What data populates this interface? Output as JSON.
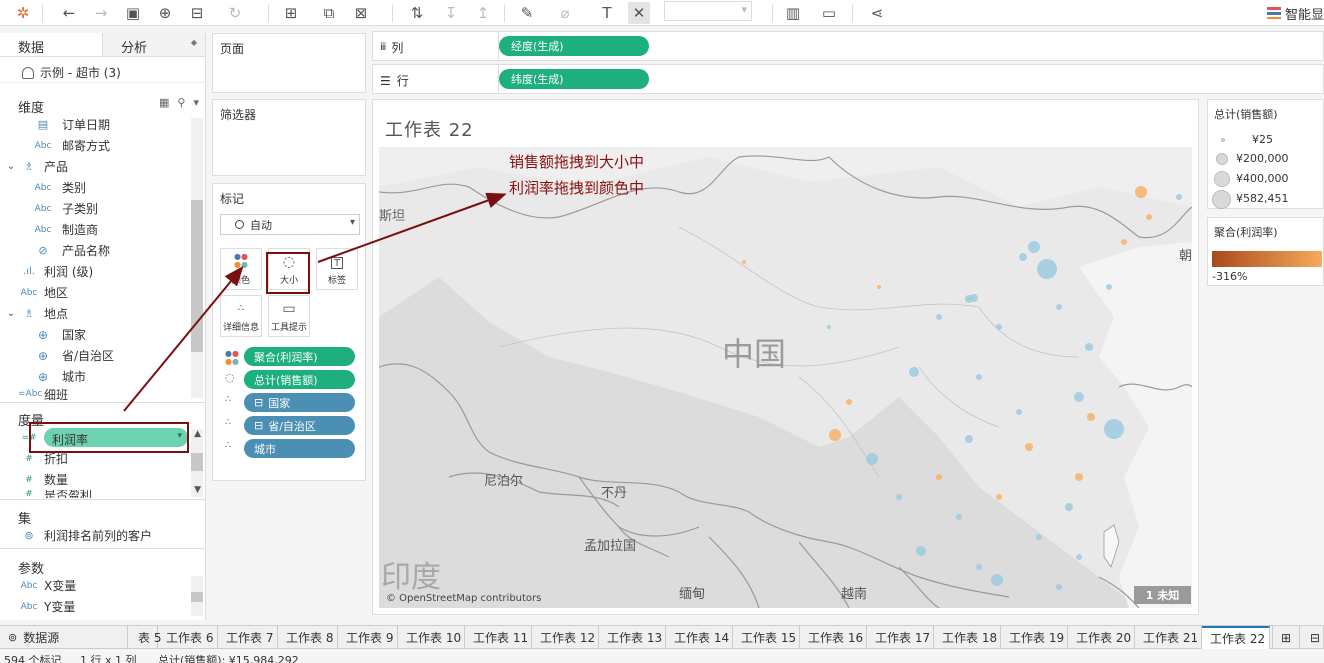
{
  "toolbar": {
    "brand_label": "智能显"
  },
  "data_pane": {
    "tab_data": "数据",
    "tab_analytics": "分析",
    "datasource": "示例 - 超市 (3)",
    "dimensions_title": "维度",
    "measures_title": "度量",
    "sets_title": "集",
    "params_title": "参数",
    "dimensions": [
      {
        "icon": "calendar-icon",
        "label": "订单日期"
      },
      {
        "icon": "Abc",
        "label": "邮寄方式"
      },
      {
        "icon": "hierarchy-icon",
        "label": "产品"
      },
      {
        "icon": "Abc",
        "label": "类别"
      },
      {
        "icon": "Abc",
        "label": "子类别"
      },
      {
        "icon": "Abc",
        "label": "制造商"
      },
      {
        "icon": "Abc",
        "label": "产品名称"
      },
      {
        "icon": "bin-icon",
        "label": "利润 (级)"
      },
      {
        "icon": "Abc",
        "label": "地区"
      },
      {
        "icon": "hierarchy-icon",
        "label": "地点"
      },
      {
        "icon": "globe-icon",
        "label": "国家"
      },
      {
        "icon": "globe-icon",
        "label": "省/自治区"
      },
      {
        "icon": "globe-icon",
        "label": "城市"
      },
      {
        "icon": "=Abc",
        "label": "细班"
      }
    ],
    "measures": [
      {
        "icon": "=#",
        "label": "利润率"
      },
      {
        "icon": "#",
        "label": "折扣"
      },
      {
        "icon": "#",
        "label": "数量"
      },
      {
        "icon": "#",
        "label": "是否盈利"
      }
    ],
    "sets": [
      {
        "label": "利润排名前列的客户"
      }
    ],
    "params": [
      {
        "icon": "Abc",
        "label": "X变量"
      },
      {
        "icon": "Abc",
        "label": "Y变量"
      }
    ]
  },
  "shelves": {
    "pages_title": "页面",
    "filters_title": "筛选器",
    "marks_title": "标记",
    "marks_type": "自动",
    "mark_buttons": [
      {
        "label": "颜色"
      },
      {
        "label": "大小"
      },
      {
        "label": "标签"
      },
      {
        "label": "详细信息"
      },
      {
        "label": "工具提示"
      }
    ],
    "mark_pills": [
      {
        "icon": "color-dots-icon",
        "label": "聚合(利润率)"
      },
      {
        "icon": "size-icon",
        "label": "总计(销售额)"
      },
      {
        "icon": "detail-icon",
        "label": "国家"
      },
      {
        "icon": "detail-icon",
        "label": "省/自治区"
      },
      {
        "icon": "detail-icon",
        "label": "城市"
      }
    ],
    "columns_label": "列",
    "columns_pill": "经度(生成)",
    "rows_label": "行",
    "rows_pill": "纬度(生成)"
  },
  "view": {
    "title": "工作表 22",
    "map_labels": {
      "china": "中国",
      "pakistan": "斯坦",
      "nepal": "尼泊尔",
      "bhutan": "不丹",
      "bangladesh": "孟加拉国",
      "india": "印度",
      "myanmar": "缅甸",
      "vietnam": "越南",
      "korea": "朝"
    },
    "attribution": "© OpenStreetMap contributors",
    "unknown_badge": "1 未知"
  },
  "legends": {
    "size_title": "总计(销售额)",
    "size_items": [
      "¥25",
      "¥200,000",
      "¥400,000",
      "¥582,451"
    ],
    "color_title": "聚合(利润率)",
    "color_min": "-316%",
    "color_start": "#a94a1c",
    "color_end": "#f6ab5b"
  },
  "annotation": {
    "line1": "销售额拖拽到大小中",
    "line2": "利润率拖拽到颜色中",
    "color": "#8b1010"
  },
  "sheet_tabs": {
    "datasource_tab": "数据源",
    "tabs": [
      "表 5",
      "工作表 6",
      "工作表 7",
      "工作表 8",
      "工作表 9",
      "工作表 10",
      "工作表 11",
      "工作表 12",
      "工作表 13",
      "工作表 14",
      "工作表 15",
      "工作表 16",
      "工作表 17",
      "工作表 18",
      "工作表 19",
      "工作表 20",
      "工作表 21",
      "工作表 22"
    ],
    "active": "工作表 22"
  },
  "status": {
    "marks": "594 个标记",
    "rows_cols": "1 行 x 1 列",
    "sum": "总计(销售额): ¥15,984,292"
  }
}
